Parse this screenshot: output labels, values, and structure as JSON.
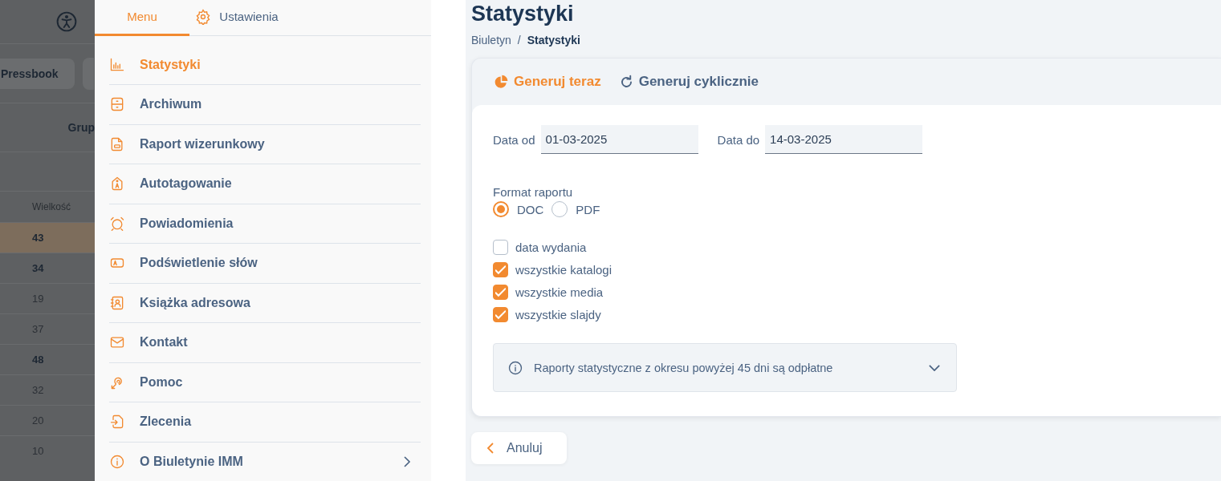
{
  "background_page": {
    "toolbar_button": "Pressbook",
    "group_header": "Grup",
    "column_header": "Wielkość",
    "rows": [
      {
        "value": "43",
        "highlighted": true,
        "bold": true
      },
      {
        "value": "34",
        "highlighted": false,
        "bold": true
      },
      {
        "value": "19",
        "highlighted": false,
        "bold": false
      },
      {
        "value": "37",
        "highlighted": false,
        "bold": false
      },
      {
        "value": "48",
        "highlighted": false,
        "bold": true
      },
      {
        "value": "32",
        "highlighted": false,
        "bold": false
      },
      {
        "value": "20",
        "highlighted": false,
        "bold": false
      },
      {
        "value": "10",
        "highlighted": false,
        "bold": false
      }
    ]
  },
  "drawer": {
    "tabs": [
      {
        "label": "Menu",
        "selected": true
      },
      {
        "label": "Ustawienia",
        "selected": false
      }
    ],
    "items": [
      {
        "label": "Statystyki",
        "selected": true,
        "submenu": false
      },
      {
        "label": "Archiwum",
        "selected": false,
        "submenu": false
      },
      {
        "label": "Raport wizerunkowy",
        "selected": false,
        "submenu": false
      },
      {
        "label": "Autotagowanie",
        "selected": false,
        "submenu": false
      },
      {
        "label": "Powiadomienia",
        "selected": false,
        "submenu": false
      },
      {
        "label": "Podświetlenie słów",
        "selected": false,
        "submenu": false
      },
      {
        "label": "Książka adresowa",
        "selected": false,
        "submenu": false
      },
      {
        "label": "Kontakt",
        "selected": false,
        "submenu": false
      },
      {
        "label": "Pomoc",
        "selected": false,
        "submenu": false
      },
      {
        "label": "Zlecenia",
        "selected": false,
        "submenu": false
      },
      {
        "label": "O Biuletynie IMM",
        "selected": false,
        "submenu": true
      }
    ]
  },
  "page": {
    "title": "Statystyki",
    "breadcrumb": [
      {
        "label": "Biuletyn",
        "current": false
      },
      {
        "label": "Statystyki",
        "current": true
      }
    ],
    "breadcrumb_separator": "/",
    "tabs": [
      {
        "label": "Generuj teraz",
        "selected": true
      },
      {
        "label": "Generuj cyklicznie",
        "selected": false
      }
    ],
    "fields": [
      {
        "label": "Data od",
        "value": "01-03-2025"
      },
      {
        "label": "Data do",
        "value": "14-03-2025"
      }
    ],
    "format": {
      "label": "Format raportu",
      "options": [
        {
          "label": "DOC",
          "selected": true
        },
        {
          "label": "PDF",
          "selected": false
        }
      ]
    },
    "checkboxes": [
      {
        "label": "data wydania",
        "checked": false
      },
      {
        "label": "wszystkie katalogi",
        "checked": true
      },
      {
        "label": "wszystkie media",
        "checked": true
      },
      {
        "label": "wszystkie slajdy",
        "checked": true
      }
    ],
    "notice": {
      "text": "Raporty statystyczne z okresu powyżej 45 dni są odpłatne",
      "expanded": false
    },
    "cancel_button": "Anuluj"
  }
}
